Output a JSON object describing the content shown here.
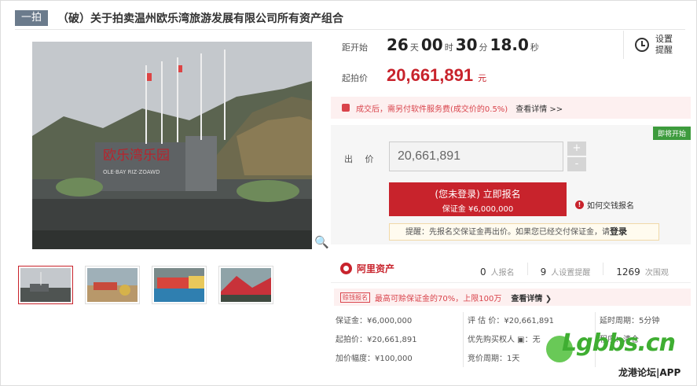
{
  "header": {
    "tag": "一拍",
    "title": "（破）关于拍卖温州欧乐湾旅游发展有限公司所有资产组合"
  },
  "gallery": {
    "main_sign_text": "欧乐湾乐园",
    "main_sign_sub": "OLE·BAY RIZ·ZOAWD",
    "zoom_icon": "magnifier-icon",
    "thumb_count": 4
  },
  "countdown": {
    "label": "距开始",
    "days": "26",
    "days_unit": "天",
    "hours": "00",
    "hours_unit": "时",
    "minutes": "30",
    "minutes_unit": "分",
    "seconds": "18.0",
    "seconds_unit": "秒"
  },
  "reminder": {
    "line1": "设置",
    "line2": "提醒",
    "icon": "alarm-clock-icon"
  },
  "start_price": {
    "label": "起拍价",
    "value": "20,661,891",
    "unit": "元"
  },
  "fee_notice": {
    "text": "成交后，需另付软件服务费(成交价的0.5%)",
    "link": "查看详情 >>"
  },
  "bid": {
    "status_badge": "即将开始",
    "label": "出 价",
    "value": "20,661,891",
    "plus": "+",
    "minus": "-",
    "signup_line1": "(您未登录) 立即报名",
    "signup_line2": "保证金 ¥6,000,000",
    "howpay": "如何交钱报名",
    "tip_text": "提醒：先报名交保证金再出价。如果您已经交付保证金，请",
    "tip_login": "登录"
  },
  "platform": {
    "name": "阿里资产"
  },
  "stats": [
    {
      "n": "0",
      "label": "人报名"
    },
    {
      "n": "9",
      "label": "人设置提醒"
    },
    {
      "n": "1269",
      "label": "次围观"
    }
  ],
  "promo": {
    "badge": "赊钱报名",
    "text": "最高可赊保证金的70%，上限100万",
    "link": "查看详情 ❯"
  },
  "info": {
    "col1": [
      "保证金：¥6,000,000",
      "起拍价：¥20,661,891",
      "加价幅度：¥100,000"
    ],
    "col2": [
      "评 估 价：¥20,661,891",
      "优先购买权人 ▣：无",
      "竞价周期：1天"
    ],
    "col3": [
      "延时周期：5分钟",
      "程序：清仓",
      ""
    ]
  },
  "watermark": {
    "brand": "Lgbbs.cn",
    "sub": "龙港论坛|APP"
  },
  "colors": {
    "accent": "#c8232c",
    "tag_bg": "#6b7b8c",
    "soon_bg": "#3d9b3d"
  }
}
